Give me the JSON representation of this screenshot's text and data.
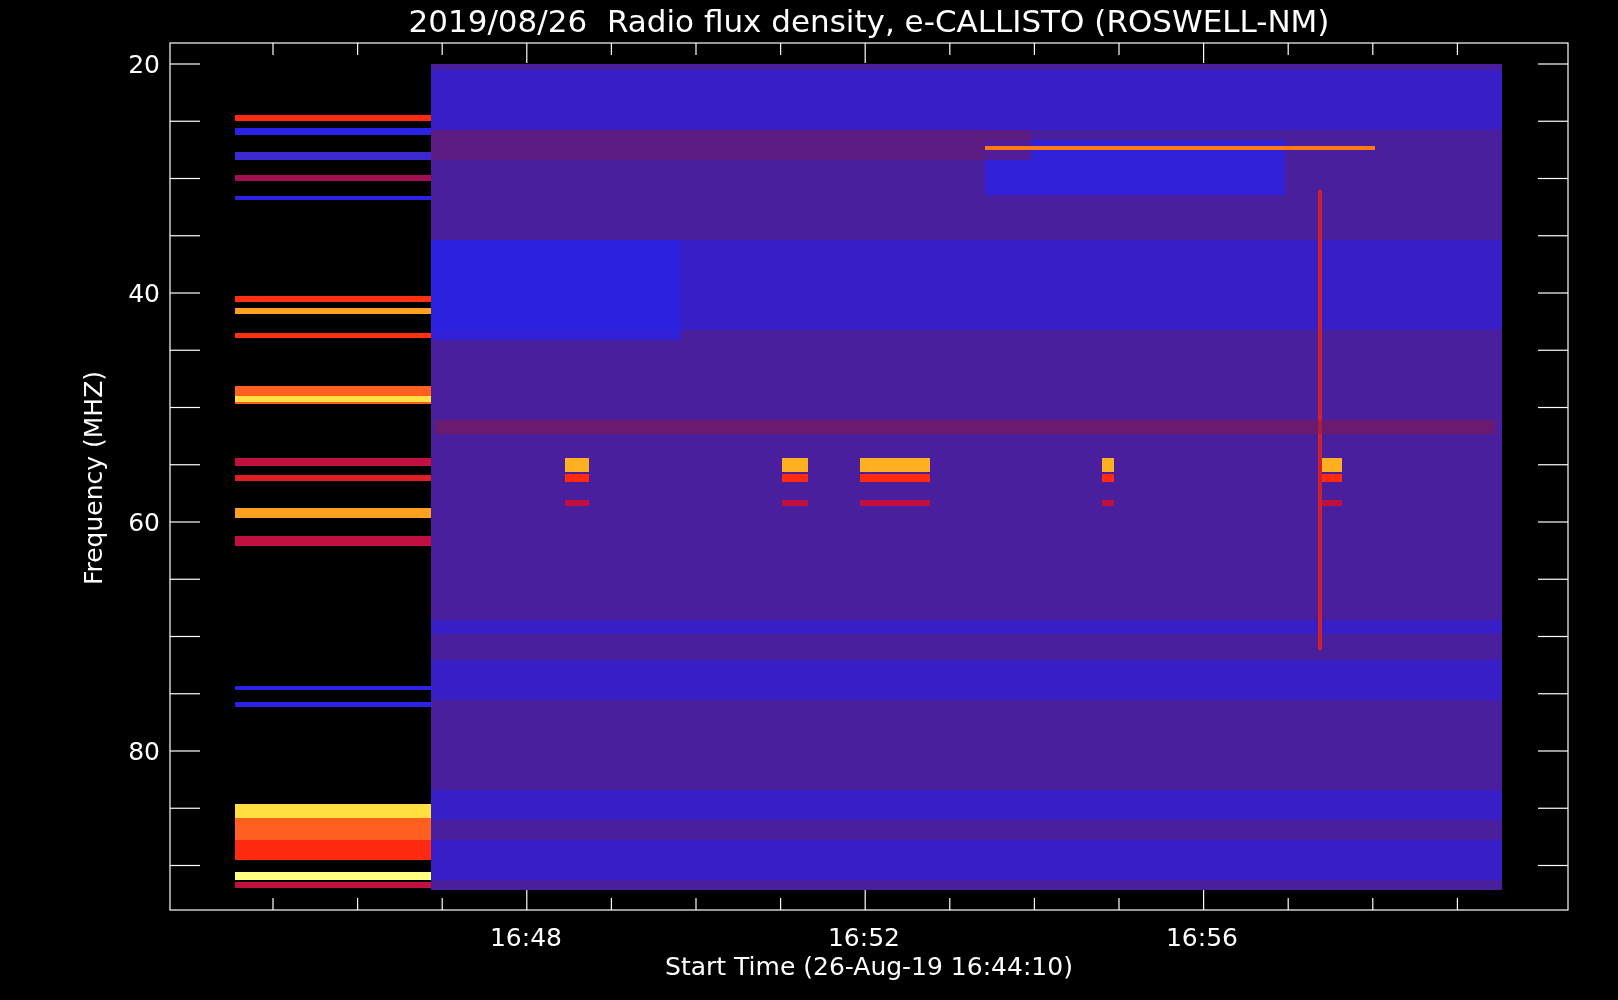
{
  "title": "2019/08/26  Radio flux density, e-CALLISTO (ROSWELL-NM)",
  "y_axis": {
    "label": "Frequency (MHZ)",
    "ticks": [
      "20",
      "40",
      "60",
      "80"
    ]
  },
  "x_axis": {
    "label": "Start Time (26-Aug-19 16:44:10)",
    "ticks": [
      "16:48",
      "16:52",
      "16:56"
    ]
  }
}
